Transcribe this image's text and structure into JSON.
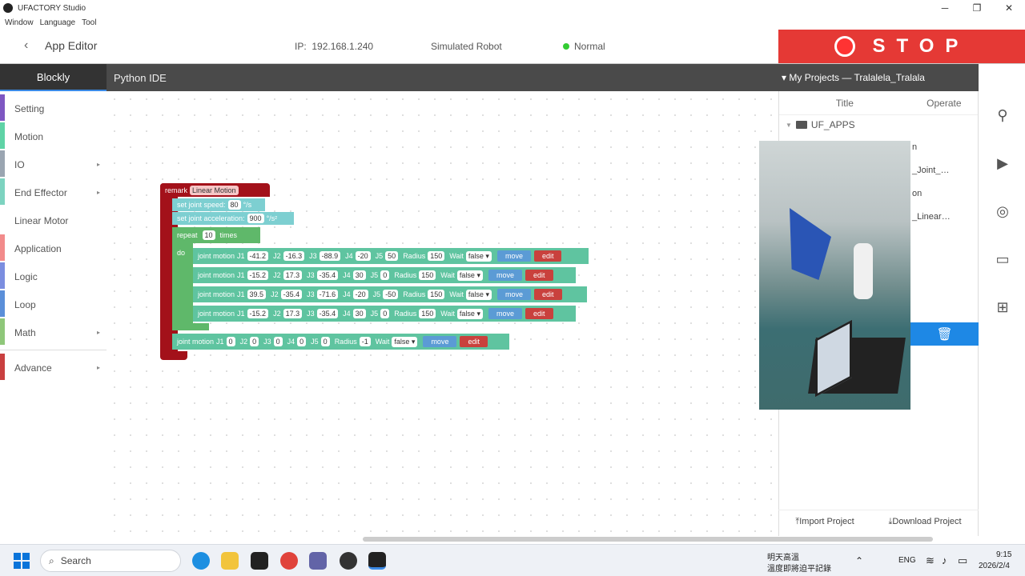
{
  "window": {
    "title": "UFACTORY Studio",
    "minimize": "─",
    "maximize": "❐",
    "close": "✕"
  },
  "menu": [
    "Window",
    "Language",
    "Tool"
  ],
  "header": {
    "back": "‹",
    "title": "App Editor",
    "ip_label": "IP:",
    "ip_value": "192.168.1.240",
    "robot": "Simulated Robot",
    "status": "Normal",
    "status_color": "#33cc33"
  },
  "stop": {
    "label": "STOP",
    "color": "#e53935"
  },
  "tabs": {
    "blockly": "Blockly",
    "python": "Python IDE"
  },
  "sidebar": [
    {
      "label": "Setting",
      "color": "#7e57c2",
      "arrow": ""
    },
    {
      "label": "Motion",
      "color": "#5fd3a6",
      "arrow": ""
    },
    {
      "label": "IO",
      "color": "#9aa5b1",
      "arrow": "▸"
    },
    {
      "label": "End Effector",
      "color": "#7dd3c0",
      "arrow": "▸"
    },
    {
      "label": "Linear Motor",
      "color": "#ffffff",
      "arrow": ""
    },
    {
      "label": "Application",
      "color": "#f28b8b",
      "arrow": ""
    },
    {
      "label": "Logic",
      "color": "#7b8ee0",
      "arrow": ""
    },
    {
      "label": "Loop",
      "color": "#5b8fd9",
      "arrow": ""
    },
    {
      "label": "Math",
      "color": "#8fc77a",
      "arrow": "▸"
    },
    {
      "label": "Advance",
      "color": "#c94040",
      "arrow": "▸"
    }
  ],
  "blocks": {
    "remark": "remark",
    "remark_value": "Linear Motion",
    "speed_label": "set joint speed:",
    "speed_value": "80",
    "speed_unit": "°/s",
    "acc_label": "set joint acceleration:",
    "acc_value": "900",
    "acc_unit": "°/s²",
    "repeat": "repeat",
    "repeat_value": "10",
    "times": "times",
    "do": "do",
    "motions": [
      [
        "-41.2",
        "-16.3",
        "-88.9",
        "-20",
        "50",
        "150",
        "false"
      ],
      [
        "-15.2",
        "17.3",
        "-35.4",
        "30",
        "0",
        "150",
        "false"
      ],
      [
        "39.5",
        "-35.4",
        "-71.6",
        "-20",
        "-50",
        "150",
        "false"
      ],
      [
        "-15.2",
        "17.3",
        "-35.4",
        "30",
        "0",
        "150",
        "false"
      ]
    ],
    "final_motion": [
      "0",
      "0",
      "0",
      "0",
      "0",
      "-1",
      "false"
    ],
    "joint_motion": "joint motion",
    "j1": "J1",
    "j2": "J2",
    "j3": "J3",
    "j4": "J4",
    "j5": "J5",
    "radius": "Radius",
    "wait": "Wait",
    "move": "move",
    "edit": "edit"
  },
  "projects": {
    "header": "▾ My Projects — Tralalela_Tralala",
    "col_title": "Title",
    "col_operate": "Operate",
    "folder": "UF_APPS",
    "rows": [
      "n",
      "_Joint_…",
      "on",
      "_Linear…"
    ],
    "import": "⤒Import Project",
    "download": "⤓Download Project"
  },
  "taskbar": {
    "search": "Search",
    "weather1": "明天高溫",
    "weather2": "溫度即將迫平記錄",
    "lang": "ENG",
    "time": "9:15",
    "date": "2026/2/4"
  }
}
